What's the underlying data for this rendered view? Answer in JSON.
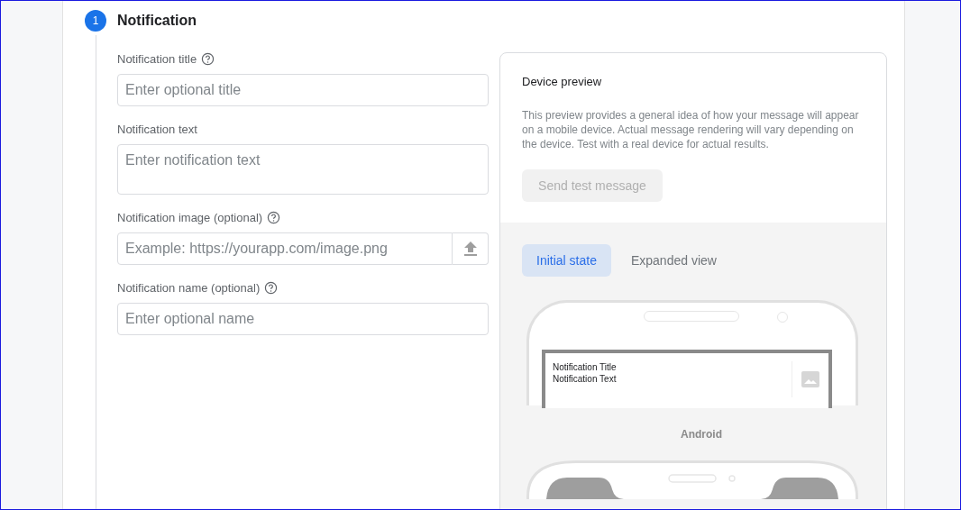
{
  "step": {
    "number": "1",
    "title": "Notification"
  },
  "fields": [
    {
      "kind": "input",
      "label": "Notification title",
      "help": true,
      "placeholder": "Enter optional title"
    },
    {
      "kind": "textarea",
      "label": "Notification text",
      "help": false,
      "placeholder": "Enter notification text"
    },
    {
      "kind": "upload",
      "label": "Notification image (optional)",
      "help": true,
      "placeholder": "Example: https://yourapp.com/image.png"
    },
    {
      "kind": "input",
      "label": "Notification name (optional)",
      "help": true,
      "placeholder": "Enter optional name"
    }
  ],
  "preview": {
    "title": "Device preview",
    "description": "This preview provides a general idea of how your message will appear on a mobile device. Actual message rendering will vary depending on the device. Test with a real device for actual results.",
    "button": {
      "label": "Send test message",
      "disabled": true
    },
    "tabs": [
      {
        "label": "Initial state",
        "selected": true
      },
      {
        "label": "Expanded view",
        "selected": false
      }
    ],
    "notification": {
      "title": "Notification Title",
      "text": "Notification Text"
    },
    "platform": "Android"
  }
}
